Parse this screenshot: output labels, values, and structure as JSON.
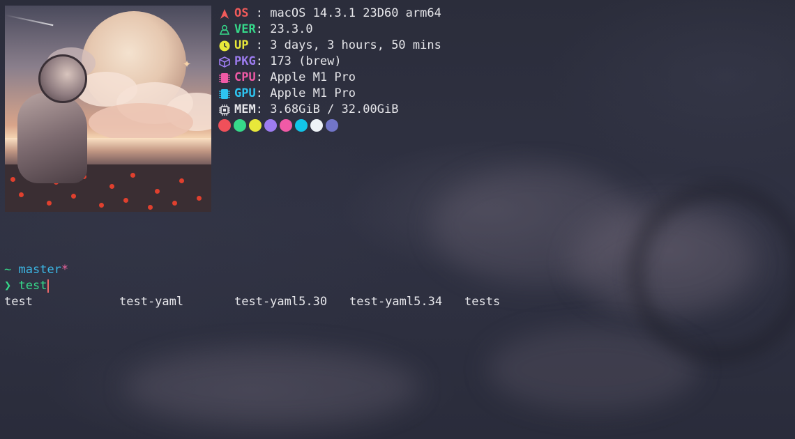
{
  "sysinfo": {
    "os": {
      "key": "OS",
      "sep": " : ",
      "value": "macOS 14.3.1 23D60 arm64",
      "color": "#f05a5a",
      "icon": "rocket-icon"
    },
    "ver": {
      "key": "VER",
      "sep": ": ",
      "value": "23.3.0",
      "color": "#36d98a",
      "icon": "linux-penguin-icon"
    },
    "up": {
      "key": "UP",
      "sep": " : ",
      "value": "3 days, 3 hours, 50 mins",
      "color": "#e8e83a",
      "icon": "clock-icon"
    },
    "pkg": {
      "key": "PKG",
      "sep": ": ",
      "value": "173 (brew)",
      "color": "#9d7cf0",
      "icon": "package-icon"
    },
    "cpu": {
      "key": "CPU",
      "sep": ": ",
      "value": "Apple M1 Pro",
      "color": "#f05aa6",
      "icon": "cpu-chip-icon"
    },
    "gpu": {
      "key": "GPU",
      "sep": ": ",
      "value": "Apple M1 Pro",
      "color": "#2ec4f0",
      "icon": "gpu-chip-icon"
    },
    "mem": {
      "key": "MEM",
      "sep": ": ",
      "value": "3.68GiB / 32.00GiB",
      "color": "#e6e6ea",
      "icon": "memory-chip-icon"
    }
  },
  "palette": [
    "#f0505a",
    "#36d98a",
    "#e8e83a",
    "#9d7cf0",
    "#f05aa6",
    "#12c4e8",
    "#eef3f7",
    "#7275c8"
  ],
  "prompt": {
    "dir": "~",
    "branch": "master",
    "dirty": "*",
    "arrow": "❯",
    "input": "test",
    "dir_color": "#36d98a",
    "branch_color": "#3cb8e6",
    "dirty_color": "#e8649c"
  },
  "completions": [
    "test",
    "test-yaml",
    "test-yaml5.30",
    "test-yaml5.34",
    "tests"
  ]
}
